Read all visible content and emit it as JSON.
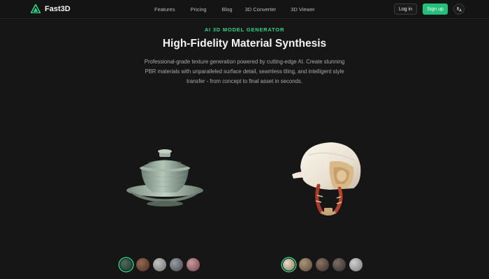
{
  "nav": {
    "brand": "Fast3D",
    "links": [
      "Features",
      "Pricing",
      "Blog",
      "3D Converter",
      "3D Viewer"
    ],
    "login": "Log in",
    "signup": "Sign up",
    "lang_icon": "translate-icon"
  },
  "hero": {
    "eyebrow": "AI 3D MODEL GENERATOR",
    "title": "High-Fidelity Material Synthesis",
    "description": "Professional-grade texture generation powered by cutting-edge AI. Create stunning PBR materials with unparalleled surface detail, seamless tiling, and intelligent style transfer - from concept to final asset in seconds."
  },
  "showcase": {
    "left_model": "tea-cup-model",
    "right_model": "helmet-model",
    "left_swatches": [
      "#2c4a3c",
      "#6b4635",
      "#9a9a9a",
      "#6d7074",
      "#a6707a"
    ],
    "right_swatches": [
      "#3a5b45",
      "#8c7a62",
      "#6e5b52",
      "#5d5450",
      "#a9a9a9"
    ]
  },
  "colors": {
    "accent": "#22c07a",
    "background": "#161616"
  }
}
